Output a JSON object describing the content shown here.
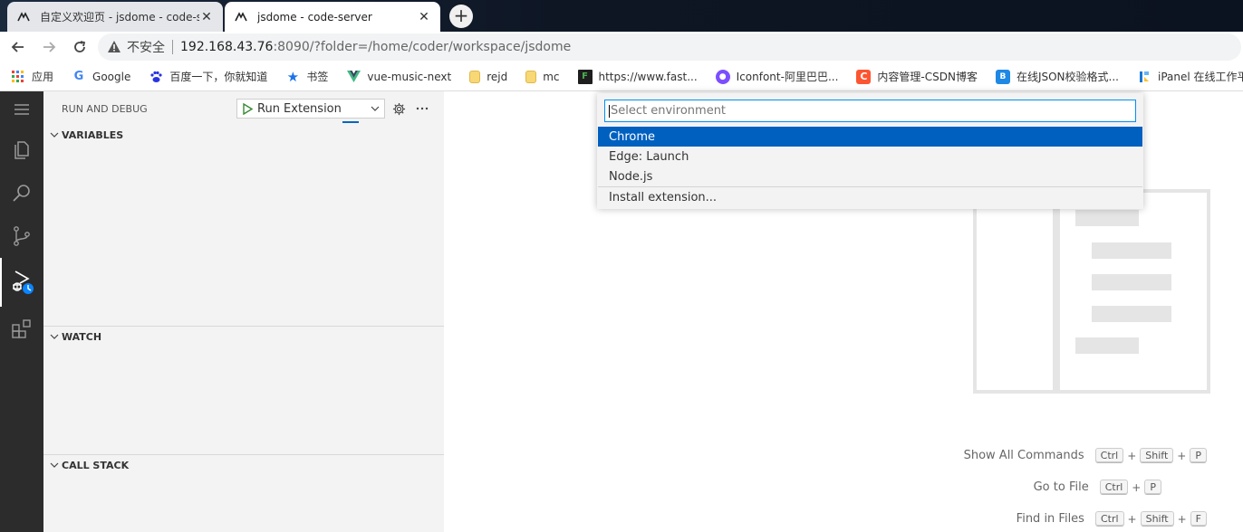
{
  "browser": {
    "tabs": [
      {
        "title": "自定义欢迎页 - jsdome - code-server",
        "active": false
      },
      {
        "title": "jsdome - code-server",
        "active": true
      }
    ],
    "new_tab": "+",
    "address": {
      "insecure_label": "不安全",
      "host": "192.168.43.76",
      "rest": ":8090/?folder=/home/coder/workspace/jsdome"
    },
    "bookmarks": [
      {
        "label": "应用",
        "icon": "apps-grid-icon",
        "color": "#e94235"
      },
      {
        "label": "Google",
        "icon": "google-icon",
        "color": "#4285f4"
      },
      {
        "label": "百度一下，你就知道",
        "icon": "baidu-paw-icon",
        "color": "#2932e1"
      },
      {
        "label": "书签",
        "icon": "star-icon",
        "color": "#1a73e8"
      },
      {
        "label": "vue-music-next",
        "icon": "vue-logo-icon",
        "color": "#41b883"
      },
      {
        "label": "rejd",
        "icon": "folder-icon",
        "color": "#f8d775"
      },
      {
        "label": "mc",
        "icon": "folder-icon",
        "color": "#f8d775"
      },
      {
        "label": "https://www.fast...",
        "icon": "fastgit-icon",
        "color": "#1e1e1e"
      },
      {
        "label": "Iconfont-阿里巴巴...",
        "icon": "iconfont-icon",
        "color": "#7c4dff"
      },
      {
        "label": "内容管理-CSDN博客",
        "icon": "csdn-icon",
        "color": "#fc5531"
      },
      {
        "label": "在线JSON校验格式...",
        "icon": "json-icon",
        "color": "#1e88e5"
      },
      {
        "label": "iPanel 在线工作平台",
        "icon": "ipanel-icon",
        "color": "#1976d2"
      }
    ]
  },
  "vscode": {
    "sidebar": {
      "title": "RUN AND DEBUG",
      "launch_config": "Run Extension",
      "sections": [
        "VARIABLES",
        "WATCH",
        "CALL STACK"
      ]
    },
    "quick_pick": {
      "placeholder": "Select environment",
      "items": [
        "Chrome",
        "Edge: Launch",
        "Node.js",
        "Install extension..."
      ],
      "selected": "Chrome"
    },
    "shortcuts": [
      {
        "label": "Show All Commands",
        "keys": [
          "Ctrl",
          "Shift",
          "P"
        ]
      },
      {
        "label": "Go to File",
        "keys": [
          "Ctrl",
          "P"
        ]
      },
      {
        "label": "Find in Files",
        "keys": [
          "Ctrl",
          "Shift",
          "F"
        ]
      }
    ],
    "colors": {
      "activity_bar": "#2c2c2c",
      "sidebar_bg": "#f3f3f3",
      "selection": "#0060c0",
      "focus_border": "#0090f1"
    }
  }
}
